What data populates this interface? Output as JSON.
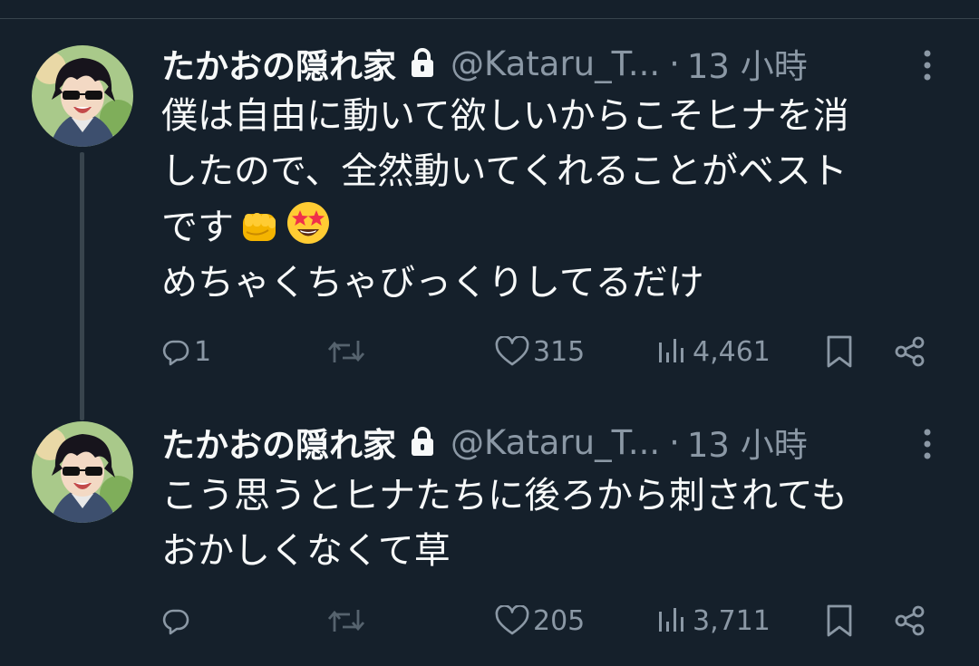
{
  "tweets": [
    {
      "name": "たかおの隠れ家",
      "handle": "@Kataru_T...",
      "separator": "·",
      "time": "13 小時",
      "lines": [
        "僕は自由に動いて欲しいからこそヒナを消",
        "したので、全然動いてくれることがベスト",
        "です",
        "めちゃくちゃびっくりしてるだけ"
      ],
      "emojis": [
        "oncoming-fist-emoji",
        "star-struck-emoji"
      ],
      "replies": "1",
      "retweets": "",
      "likes": "315",
      "views": "4,461"
    },
    {
      "name": "たかおの隠れ家",
      "handle": "@Kataru_T...",
      "separator": "·",
      "time": "13 小時",
      "lines": [
        "こう思うとヒナたちに後ろから刺されても",
        "おかしくなくて草"
      ],
      "replies": "",
      "retweets": "",
      "likes": "205",
      "views": "3,711"
    }
  ],
  "colors": {
    "background": "#15202b",
    "text": "#f7f9f9",
    "secondary": "#8b98a5",
    "thread_line": "#38444d"
  }
}
